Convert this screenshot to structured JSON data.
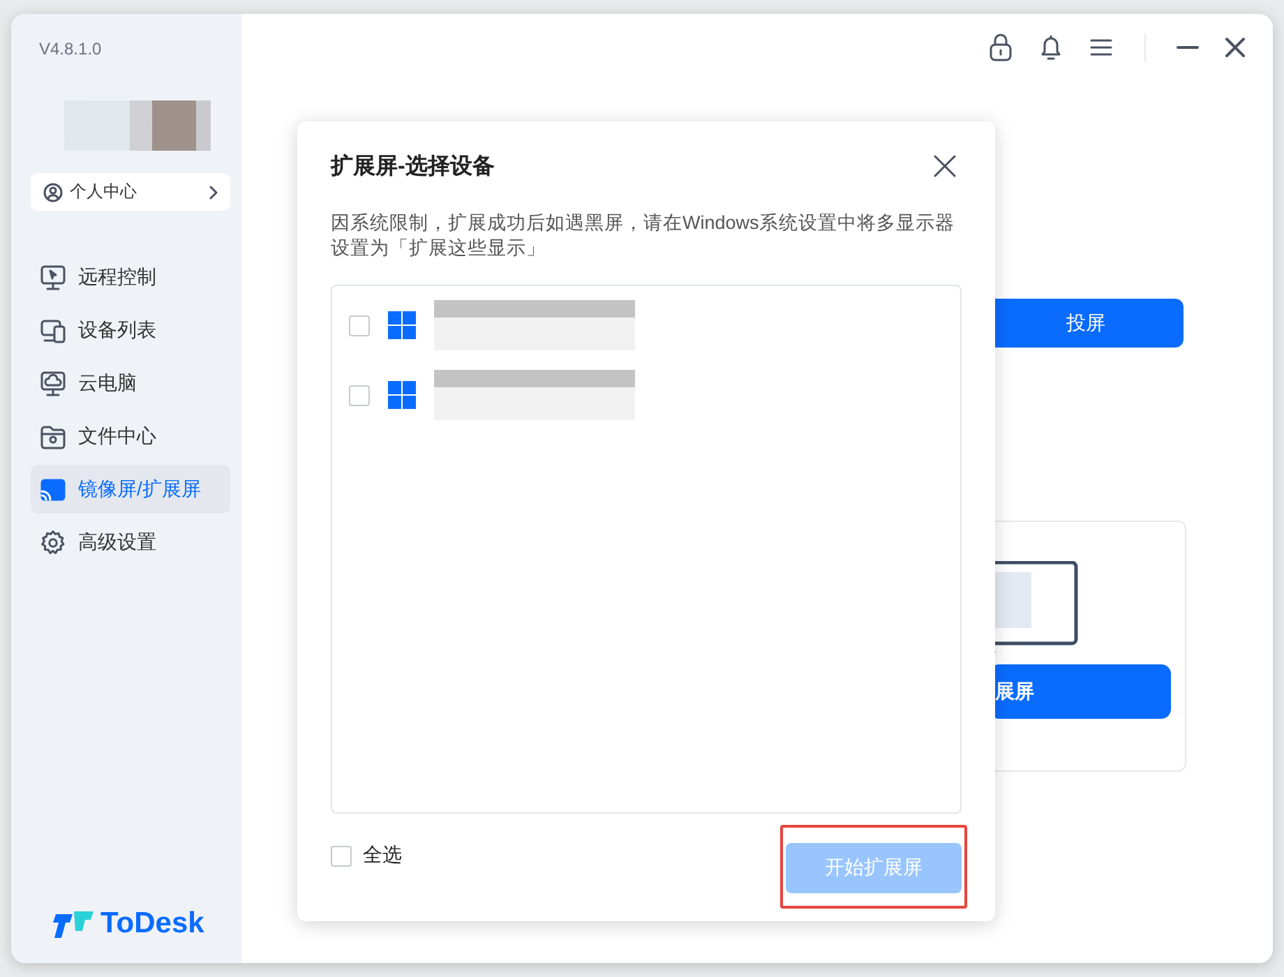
{
  "app": {
    "version": "V4.8.1.0",
    "brand": "ToDesk"
  },
  "profile": {
    "label": "个人中心"
  },
  "sidebar": {
    "items": [
      {
        "label": "远程控制",
        "kind": "monitor",
        "selected": false
      },
      {
        "label": "设备列表",
        "kind": "devices",
        "selected": false
      },
      {
        "label": "云电脑",
        "kind": "cloud",
        "selected": false
      },
      {
        "label": "文件中心",
        "kind": "folder",
        "selected": false
      },
      {
        "label": "镜像屏/扩展屏",
        "kind": "cast",
        "selected": true
      },
      {
        "label": "高级设置",
        "kind": "gear",
        "selected": false
      }
    ]
  },
  "main": {
    "cast_button": "投屏",
    "extend_button": "展屏"
  },
  "dialog": {
    "title": "扩展屏-选择设备",
    "notice": "因系统限制，扩展成功后如遇黑屏，请在Windows系统设置中将多显示器设置为「扩展这些显示」",
    "devices": [
      {
        "checked": false
      },
      {
        "checked": false
      }
    ],
    "select_all": {
      "label": "全选",
      "checked": false
    },
    "start_button": {
      "label": "开始扩展屏",
      "disabled": true
    }
  }
}
